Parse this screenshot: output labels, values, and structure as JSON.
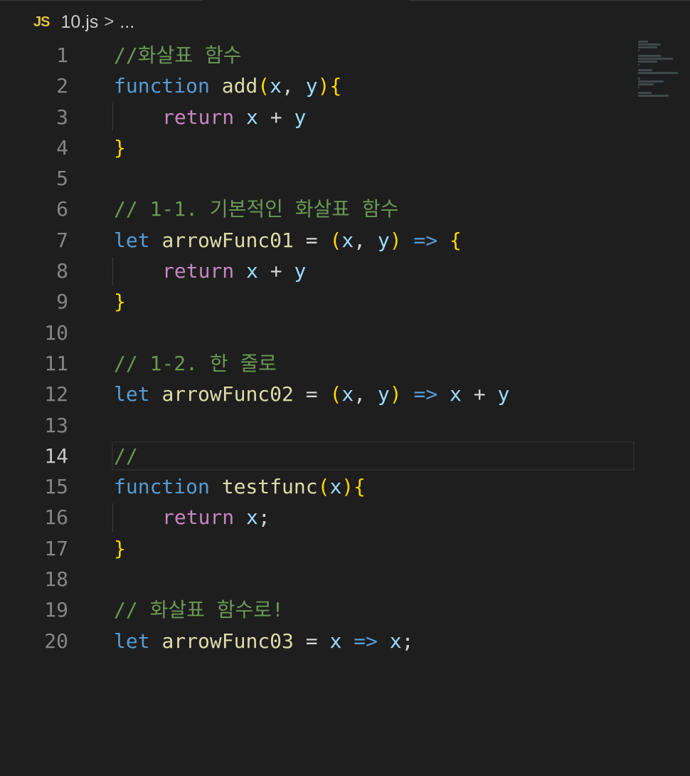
{
  "breadcrumb": {
    "file_icon": "JS",
    "file_name": "10.js",
    "separator": ">",
    "more": "..."
  },
  "editor": {
    "current_line": 14,
    "lines": [
      {
        "n": "1",
        "tokens": [
          {
            "t": "//화살표 함수",
            "c": "comment"
          }
        ]
      },
      {
        "n": "2",
        "tokens": [
          {
            "t": "function",
            "c": "kw"
          },
          {
            "t": " ",
            "c": "op"
          },
          {
            "t": "add",
            "c": "fn"
          },
          {
            "t": "(",
            "c": "paren"
          },
          {
            "t": "x",
            "c": "var"
          },
          {
            "t": ", ",
            "c": "op"
          },
          {
            "t": "y",
            "c": "var"
          },
          {
            "t": ")",
            "c": "paren"
          },
          {
            "t": "{",
            "c": "brace"
          }
        ]
      },
      {
        "n": "3",
        "indent": true,
        "tokens": [
          {
            "t": "return",
            "c": "ret"
          },
          {
            "t": " ",
            "c": "op"
          },
          {
            "t": "x",
            "c": "var"
          },
          {
            "t": " + ",
            "c": "op"
          },
          {
            "t": "y",
            "c": "var"
          }
        ]
      },
      {
        "n": "4",
        "tokens": [
          {
            "t": "}",
            "c": "brace"
          }
        ]
      },
      {
        "n": "5",
        "tokens": []
      },
      {
        "n": "6",
        "tokens": [
          {
            "t": "// 1-1. 기본적인 화살표 함수",
            "c": "comment"
          }
        ]
      },
      {
        "n": "7",
        "tokens": [
          {
            "t": "let",
            "c": "kw"
          },
          {
            "t": " ",
            "c": "op"
          },
          {
            "t": "arrowFunc01",
            "c": "fn"
          },
          {
            "t": " = ",
            "c": "op"
          },
          {
            "t": "(",
            "c": "paren"
          },
          {
            "t": "x",
            "c": "var"
          },
          {
            "t": ", ",
            "c": "op"
          },
          {
            "t": "y",
            "c": "var"
          },
          {
            "t": ")",
            "c": "paren"
          },
          {
            "t": " ",
            "c": "op"
          },
          {
            "t": "=>",
            "c": "kw"
          },
          {
            "t": " ",
            "c": "op"
          },
          {
            "t": "{",
            "c": "brace"
          }
        ]
      },
      {
        "n": "8",
        "indent": true,
        "tokens": [
          {
            "t": "return",
            "c": "ret"
          },
          {
            "t": " ",
            "c": "op"
          },
          {
            "t": "x",
            "c": "var"
          },
          {
            "t": " + ",
            "c": "op"
          },
          {
            "t": "y",
            "c": "var"
          }
        ]
      },
      {
        "n": "9",
        "tokens": [
          {
            "t": "}",
            "c": "brace"
          }
        ]
      },
      {
        "n": "10",
        "tokens": []
      },
      {
        "n": "11",
        "tokens": [
          {
            "t": "// 1-2. 한 줄로",
            "c": "comment"
          }
        ]
      },
      {
        "n": "12",
        "tokens": [
          {
            "t": "let",
            "c": "kw"
          },
          {
            "t": " ",
            "c": "op"
          },
          {
            "t": "arrowFunc02",
            "c": "fn"
          },
          {
            "t": " = ",
            "c": "op"
          },
          {
            "t": "(",
            "c": "paren"
          },
          {
            "t": "x",
            "c": "var"
          },
          {
            "t": ", ",
            "c": "op"
          },
          {
            "t": "y",
            "c": "var"
          },
          {
            "t": ")",
            "c": "paren"
          },
          {
            "t": " ",
            "c": "op"
          },
          {
            "t": "=>",
            "c": "kw"
          },
          {
            "t": " ",
            "c": "op"
          },
          {
            "t": "x",
            "c": "var"
          },
          {
            "t": " + ",
            "c": "op"
          },
          {
            "t": "y",
            "c": "var"
          }
        ]
      },
      {
        "n": "13",
        "tokens": []
      },
      {
        "n": "14",
        "tokens": [
          {
            "t": "//",
            "c": "comment"
          }
        ]
      },
      {
        "n": "15",
        "tokens": [
          {
            "t": "function",
            "c": "kw"
          },
          {
            "t": " ",
            "c": "op"
          },
          {
            "t": "testfunc",
            "c": "fn"
          },
          {
            "t": "(",
            "c": "paren"
          },
          {
            "t": "x",
            "c": "var"
          },
          {
            "t": ")",
            "c": "paren"
          },
          {
            "t": "{",
            "c": "brace"
          }
        ]
      },
      {
        "n": "16",
        "indent": true,
        "tokens": [
          {
            "t": "return",
            "c": "ret"
          },
          {
            "t": " ",
            "c": "op"
          },
          {
            "t": "x",
            "c": "var"
          },
          {
            "t": ";",
            "c": "op"
          }
        ]
      },
      {
        "n": "17",
        "tokens": [
          {
            "t": "}",
            "c": "brace"
          }
        ]
      },
      {
        "n": "18",
        "tokens": []
      },
      {
        "n": "19",
        "tokens": [
          {
            "t": "// 화살표 함수로!",
            "c": "comment"
          }
        ]
      },
      {
        "n": "20",
        "tokens": [
          {
            "t": "let",
            "c": "kw"
          },
          {
            "t": " ",
            "c": "op"
          },
          {
            "t": "arrowFunc03",
            "c": "fn"
          },
          {
            "t": " = ",
            "c": "op"
          },
          {
            "t": "x",
            "c": "var"
          },
          {
            "t": " ",
            "c": "op"
          },
          {
            "t": "=>",
            "c": "kw"
          },
          {
            "t": " ",
            "c": "op"
          },
          {
            "t": "x",
            "c": "var"
          },
          {
            "t": ";",
            "c": "op"
          }
        ]
      }
    ]
  },
  "colors": {
    "background": "#1e1e1e",
    "comment": "#6a9955",
    "keyword": "#569cd6",
    "return": "#c586c0",
    "function": "#dcdcaa",
    "variable": "#9cdcfe",
    "bracket": "#ffd700",
    "line_number": "#858585"
  }
}
